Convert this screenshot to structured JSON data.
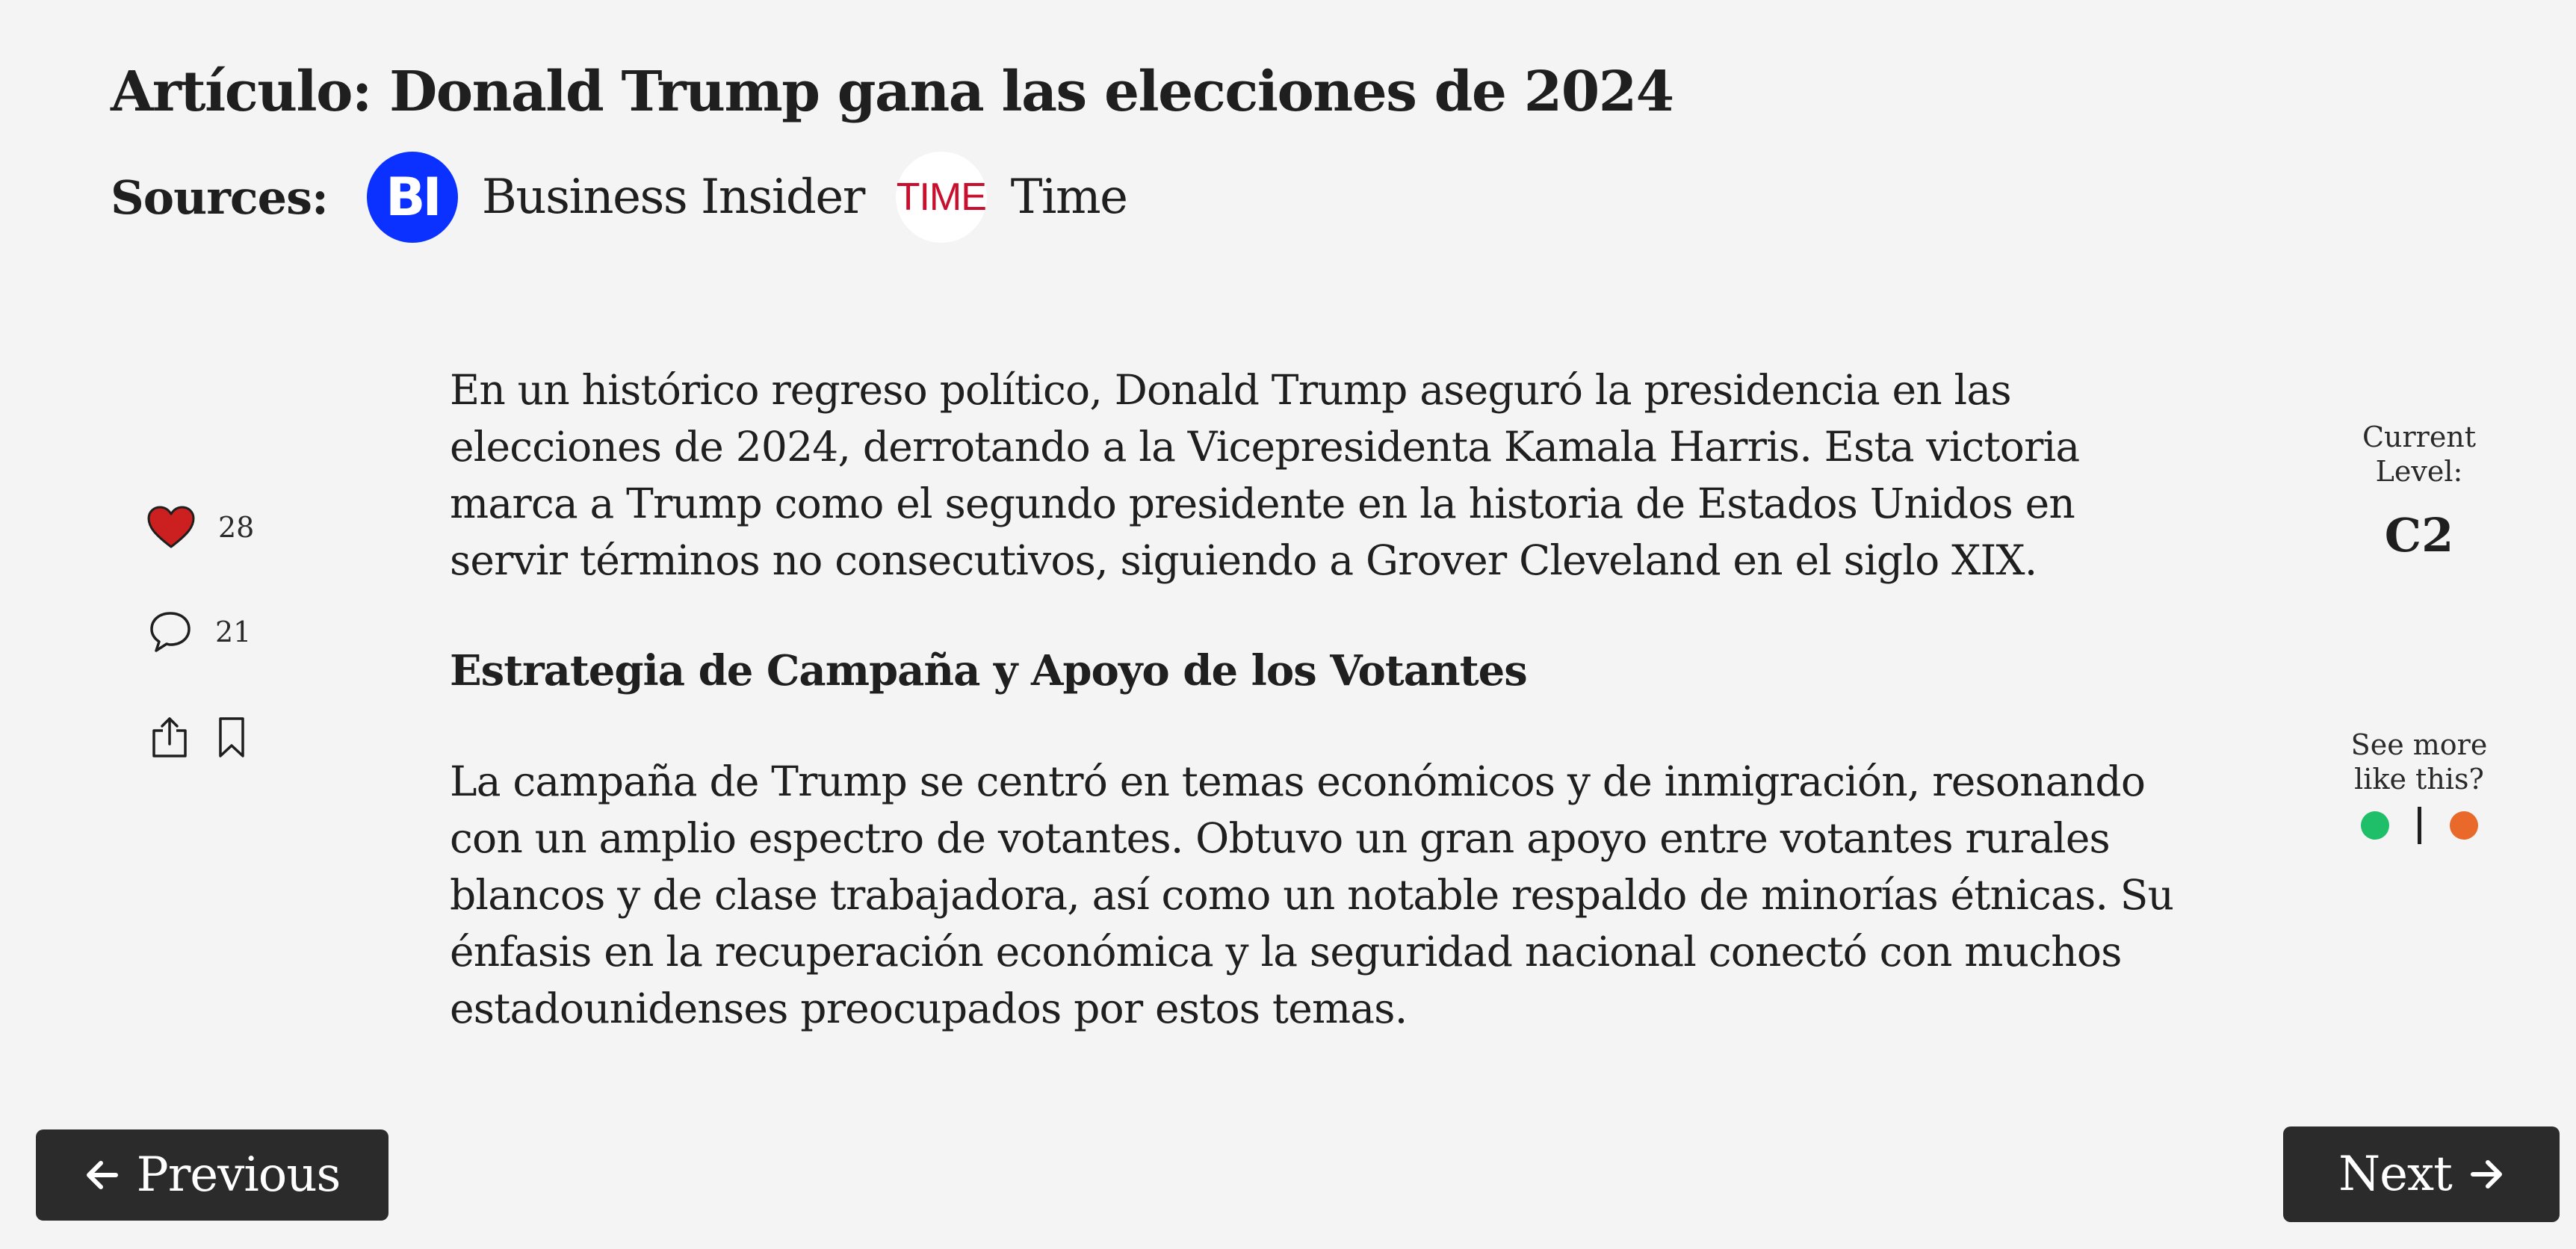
{
  "header": {
    "title": "Artículo: Donald Trump gana las elecciones de 2024",
    "sources_label": "Sources:",
    "sources": [
      {
        "logo_text": "BI",
        "name": "Business Insider",
        "logo_color": "#0a31ff"
      },
      {
        "logo_text": "TIME",
        "name": "Time",
        "logo_color": "#c8102e"
      }
    ]
  },
  "actions": {
    "likes": "28",
    "comments": "21",
    "icons": [
      "heart-icon",
      "comment-icon",
      "share-icon",
      "bookmark-icon"
    ],
    "heart_color": "#cc1f1f"
  },
  "article": {
    "paragraph_1": "En un histórico regreso político, Donald Trump aseguró la presidencia en las elecciones de 2024, derrotando a la Vicepresidenta Kamala Harris. Esta victoria marca a Trump como el segundo presidente en la historia de Estados Unidos en servir términos no consecutivos, siguiendo a Grover Cleveland en el siglo XIX.",
    "subheading": "Estrategia de Campaña y Apoyo de los Votantes",
    "paragraph_2": "La campaña de Trump se centró en temas económicos y de inmigración, resonando con un amplio espectro de votantes. Obtuvo un gran apoyo entre votantes rurales blancos y de clase trabajadora, así como un notable respaldo de minorías étnicas. Su énfasis en la recuperación económica y la seguridad nacional conectó con muchos estadounidenses preocupados por estos temas."
  },
  "sidebar": {
    "level_label_1": "Current",
    "level_label_2": "Level:",
    "level_value": "C2",
    "more_label_1": "See more",
    "more_label_2": "like this?",
    "like_color": "#1fbf6a",
    "dislike_color": "#e8692a"
  },
  "nav": {
    "previous_label": "Previous",
    "next_label": "Next"
  }
}
